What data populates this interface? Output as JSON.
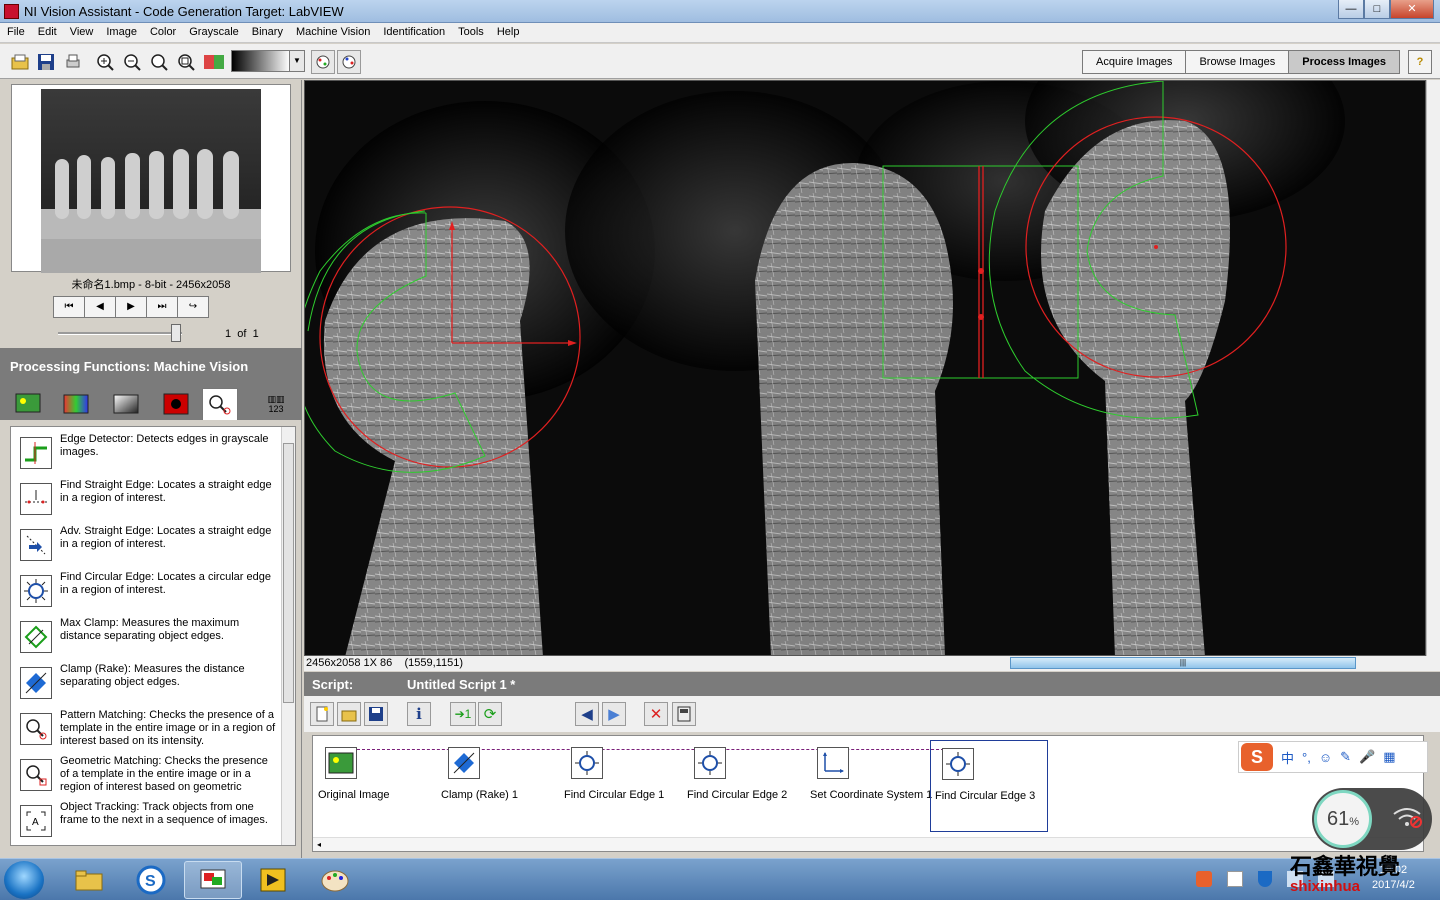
{
  "window": {
    "title": "NI Vision Assistant - Code Generation Target: LabVIEW",
    "min": "—",
    "max": "□",
    "close": "✕"
  },
  "menu": [
    "File",
    "Edit",
    "View",
    "Image",
    "Color",
    "Grayscale",
    "Binary",
    "Machine Vision",
    "Identification",
    "Tools",
    "Help"
  ],
  "mode_tabs": [
    "Acquire Images",
    "Browse Images",
    "Process Images"
  ],
  "active_mode": "Process Images",
  "help_label": "?",
  "thumbnail": {
    "caption": "未命名1.bmp - 8-bit - 2456x2058",
    "page": "1",
    "of_label": "of",
    "total": "1"
  },
  "nav_buttons": [
    "⏮",
    "◀",
    "▶",
    "⏭",
    "↪"
  ],
  "processing_functions": {
    "header": "Processing Functions: Machine Vision",
    "tab_icons": [
      "image-icon",
      "color-icon",
      "grayscale-icon",
      "binary-icon",
      "machine-vision-icon",
      "identification-icon"
    ],
    "barcode_tab_text": "123",
    "items": [
      {
        "icon": "edge-detector-icon",
        "glyph": "⊥",
        "text": "Edge Detector:  Detects edges in grayscale images."
      },
      {
        "icon": "find-straight-edge-icon",
        "glyph": "⇣",
        "text": "Find Straight Edge:  Locates a straight edge in a region of interest."
      },
      {
        "icon": "adv-straight-edge-icon",
        "glyph": "⇢",
        "text": "Adv. Straight Edge:  Locates a straight edge in a region of interest."
      },
      {
        "icon": "find-circular-edge-icon",
        "glyph": "✺",
        "text": "Find Circular Edge:  Locates a circular edge in a region of interest."
      },
      {
        "icon": "max-clamp-icon",
        "glyph": "⇔",
        "text": "Max Clamp:  Measures the maximum distance separating object edges."
      },
      {
        "icon": "clamp-rake-icon",
        "glyph": "⧫",
        "text": "Clamp (Rake):  Measures the distance separating object edges."
      },
      {
        "icon": "pattern-matching-icon",
        "glyph": "⚲",
        "text": "Pattern Matching:  Checks the presence of a template in the entire image or in a region of interest based on its intensity."
      },
      {
        "icon": "geometric-matching-icon",
        "glyph": "⚲",
        "text": "Geometric Matching:  Checks the presence of a template in the entire image or in a region of interest based on geometric"
      },
      {
        "icon": "object-tracking-icon",
        "glyph": "⟨A⟩",
        "text": "Object Tracking:  Track objects from one frame to the next in a sequence of images."
      }
    ]
  },
  "image_status": {
    "size_zoom": "2456x2058 1X 86",
    "coords": "(1559,1151)",
    "scroll_grip": "|||"
  },
  "script": {
    "label": "Script:",
    "name": "Untitled Script 1 *",
    "steps": [
      {
        "label": "Original Image",
        "icon": "original-image-icon",
        "glyph": "▣"
      },
      {
        "label": "Clamp (Rake) 1",
        "icon": "clamp-rake-icon",
        "glyph": "⧫"
      },
      {
        "label": "Find Circular Edge 1",
        "icon": "find-circular-edge-icon",
        "glyph": "✺"
      },
      {
        "label": "Find Circular Edge 2",
        "icon": "find-circular-edge-icon",
        "glyph": "✺"
      },
      {
        "label": "Set Coordinate System 1",
        "icon": "coordinate-system-icon",
        "glyph": "⊥"
      },
      {
        "label": "Find Circular Edge 3",
        "icon": "find-circular-edge-icon",
        "glyph": "✺"
      }
    ],
    "selected_step": "Find Circular Edge 3",
    "scroll_left": "◂"
  },
  "ime": {
    "logo": "S",
    "items": [
      "中",
      "°,",
      "☺",
      "✎",
      "🎤",
      "▦"
    ]
  },
  "net_widget": {
    "percent": "61",
    "unit": "%"
  },
  "taskbar": {
    "clock_time": "18:02",
    "clock_date": "2017/4/2"
  },
  "watermark": {
    "line1": "石鑫華視覺",
    "line2": "shixinhua"
  },
  "colors": {
    "accent_red": "#e02020",
    "roi_green": "#2ecc2e",
    "panel_gray": "#7b7b7b"
  }
}
